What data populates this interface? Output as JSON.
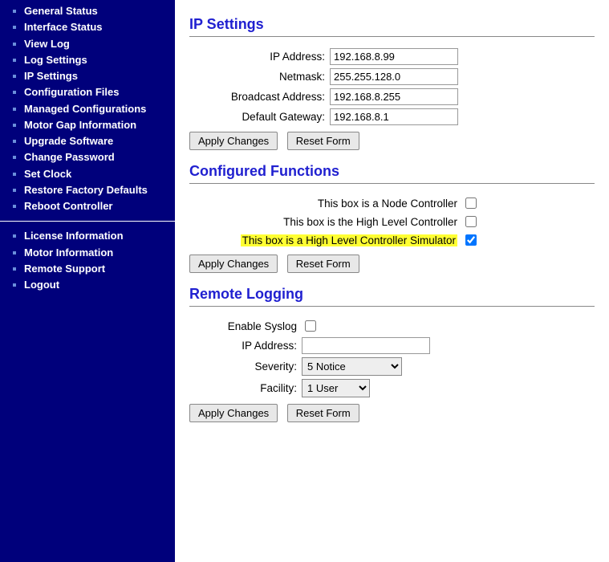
{
  "sidebar": {
    "group1": [
      "General Status",
      "Interface Status",
      "View Log",
      "Log Settings",
      "IP Settings",
      "Configuration Files",
      "Managed Configurations",
      "Motor Gap Information",
      "Upgrade Software",
      "Change Password",
      "Set Clock",
      "Restore Factory Defaults",
      "Reboot Controller"
    ],
    "group2": [
      "License Information",
      "Motor Information",
      "Remote Support",
      "Logout"
    ]
  },
  "ip_settings": {
    "title": "IP Settings",
    "ip_label": "IP Address:",
    "ip_value": "192.168.8.99",
    "netmask_label": "Netmask:",
    "netmask_value": "255.255.128.0",
    "broadcast_label": "Broadcast Address:",
    "broadcast_value": "192.168.8.255",
    "gateway_label": "Default Gateway:",
    "gateway_value": "192.168.8.1",
    "apply": "Apply Changes",
    "reset": "Reset Form"
  },
  "functions": {
    "title": "Configured Functions",
    "node_label": "This box is a Node Controller",
    "node_checked": false,
    "hlc_label": "This box is the High Level Controller",
    "hlc_checked": false,
    "sim_label": "This box is a High Level Controller Simulator",
    "sim_checked": true,
    "apply": "Apply Changes",
    "reset": "Reset Form"
  },
  "remote": {
    "title": "Remote Logging",
    "enable_label": "Enable Syslog",
    "enable_checked": false,
    "ip_label": "IP Address:",
    "ip_value": "",
    "severity_label": "Severity:",
    "severity_value": "5 Notice",
    "facility_label": "Facility:",
    "facility_value": "1 User",
    "apply": "Apply Changes",
    "reset": "Reset Form"
  }
}
